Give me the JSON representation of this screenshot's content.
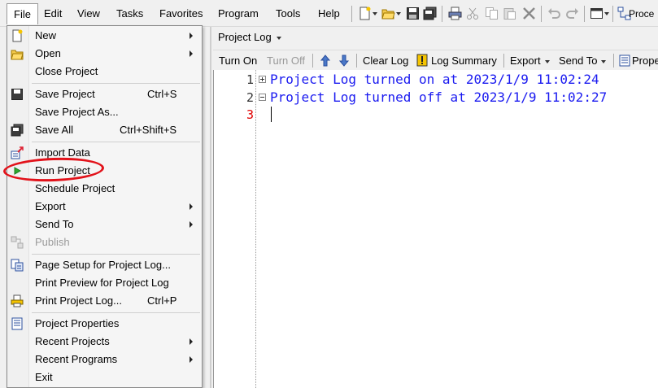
{
  "menubar": {
    "items": [
      "File",
      "Edit",
      "View",
      "Tasks",
      "Favorites",
      "Program",
      "Tools",
      "Help"
    ],
    "active": "File",
    "toolbar_icons": [
      "new-icon",
      "open-icon",
      "save-icon",
      "save-all-icon",
      "print-icon",
      "cut-icon",
      "copy-icon",
      "paste-icon",
      "delete-icon",
      "undo-icon",
      "redo-icon",
      "window-icon",
      "process-flow-icon"
    ],
    "process_label": "Proce"
  },
  "file_menu": {
    "items": [
      {
        "label": "New",
        "shortcut": "",
        "submenu": true,
        "icon": "new-icon",
        "disabled": false
      },
      {
        "label": "Open",
        "shortcut": "",
        "submenu": true,
        "icon": "open-icon",
        "disabled": false
      },
      {
        "label": "Close Project",
        "shortcut": "",
        "submenu": false,
        "icon": "",
        "disabled": false
      },
      {
        "label": "Save Project",
        "shortcut": "Ctrl+S",
        "submenu": false,
        "icon": "save-icon",
        "disabled": false
      },
      {
        "label": "Save Project As...",
        "shortcut": "",
        "submenu": false,
        "icon": "",
        "disabled": false
      },
      {
        "label": "Save All",
        "shortcut": "Ctrl+Shift+S",
        "submenu": false,
        "icon": "save-all-icon",
        "disabled": false
      },
      {
        "label": "Import Data",
        "shortcut": "",
        "submenu": false,
        "icon": "import-icon",
        "disabled": false
      },
      {
        "label": "Run Project",
        "shortcut": "",
        "submenu": false,
        "icon": "run-icon",
        "disabled": false
      },
      {
        "label": "Schedule Project",
        "shortcut": "",
        "submenu": false,
        "icon": "",
        "disabled": false
      },
      {
        "label": "Export",
        "shortcut": "",
        "submenu": true,
        "icon": "",
        "disabled": false
      },
      {
        "label": "Send To",
        "shortcut": "",
        "submenu": true,
        "icon": "",
        "disabled": false
      },
      {
        "label": "Publish",
        "shortcut": "",
        "submenu": false,
        "icon": "publish-icon",
        "disabled": true
      },
      {
        "label": "Page Setup for Project Log...",
        "shortcut": "",
        "submenu": false,
        "icon": "page-setup-icon",
        "disabled": false
      },
      {
        "label": "Print Preview for Project Log",
        "shortcut": "",
        "submenu": false,
        "icon": "",
        "disabled": false
      },
      {
        "label": "Print Project Log...",
        "shortcut": "Ctrl+P",
        "submenu": false,
        "icon": "print-icon",
        "disabled": false
      },
      {
        "label": "Project Properties",
        "shortcut": "",
        "submenu": false,
        "icon": "properties-icon",
        "disabled": false
      },
      {
        "label": "Recent Projects",
        "shortcut": "",
        "submenu": true,
        "icon": "",
        "disabled": false
      },
      {
        "label": "Recent Programs",
        "shortcut": "",
        "submenu": true,
        "icon": "",
        "disabled": false
      },
      {
        "label": "Exit",
        "shortcut": "",
        "submenu": false,
        "icon": "",
        "disabled": false
      }
    ],
    "highlighted": "Run Project"
  },
  "log_panel": {
    "tab_label": "Project Log",
    "toolbar": {
      "turn_on": "Turn On",
      "turn_off": "Turn Off",
      "clear_log": "Clear Log",
      "log_summary": "Log Summary",
      "export": "Export",
      "send_to": "Send To",
      "properties": "Prope"
    },
    "lines": [
      {
        "number": "1",
        "text": "Project Log turned on at 2023/1/9 11:02:24",
        "fold": "plus"
      },
      {
        "number": "2",
        "text": "Project Log turned off at 2023/1/9 11:02:27",
        "fold": "minus"
      },
      {
        "number": "3",
        "text": "",
        "fold": ""
      }
    ]
  },
  "colors": {
    "log_text": "#1a1af0",
    "current_line_number": "#e00000",
    "annotation_circle": "#e2121a"
  }
}
